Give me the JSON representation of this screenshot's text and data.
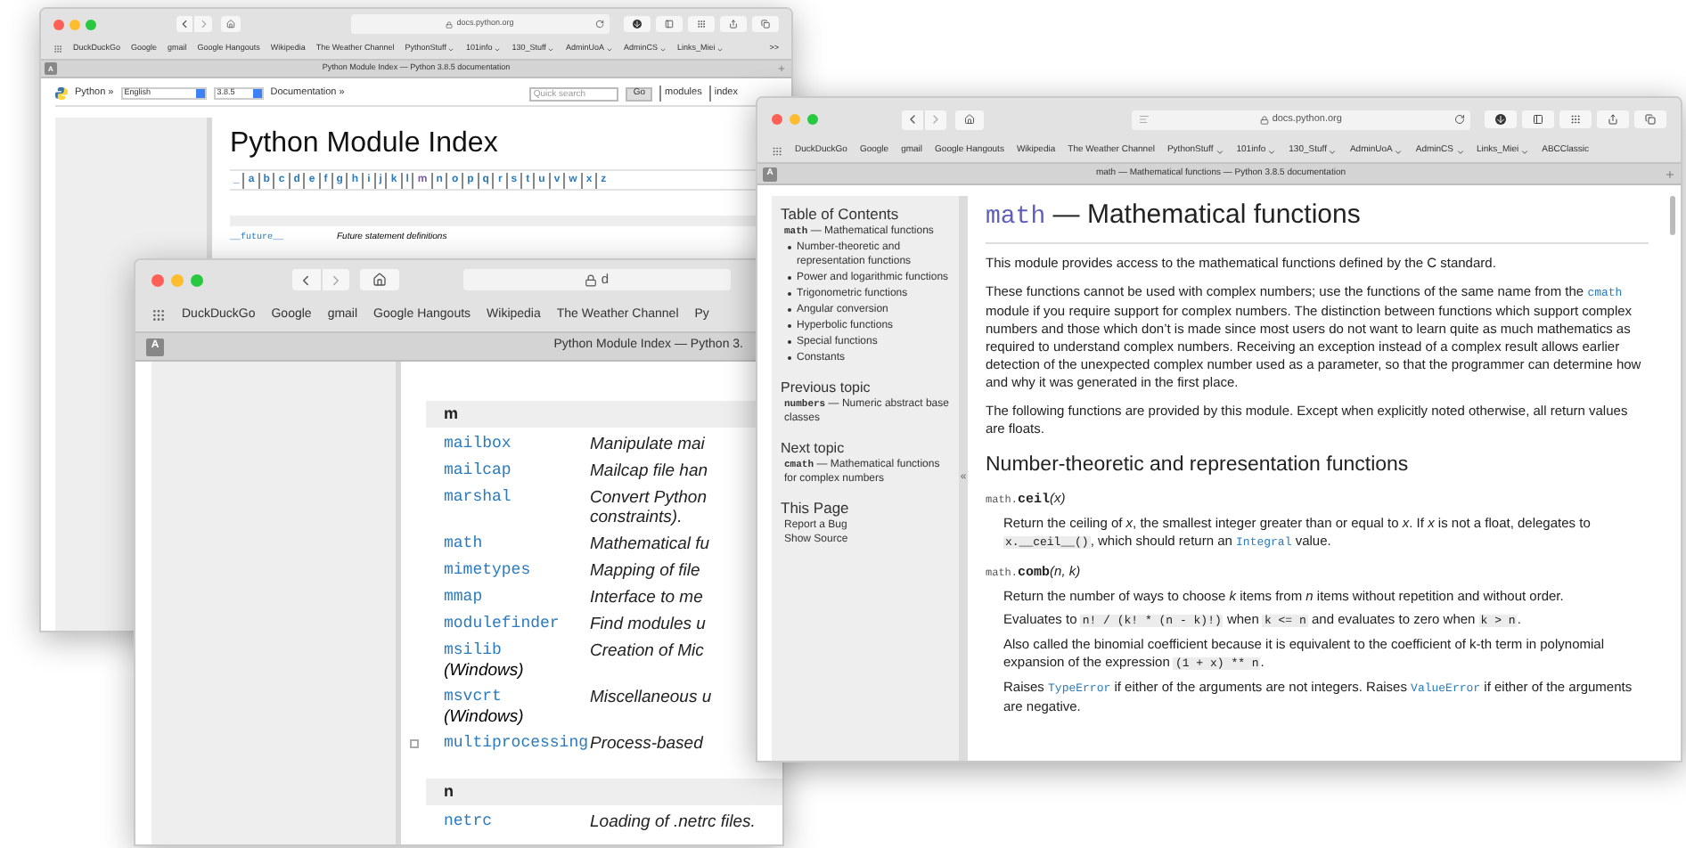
{
  "back_window": {
    "url": "docs.python.org",
    "bookmarks": [
      {
        "label": "DuckDuckGo",
        "menu": false
      },
      {
        "label": "Google",
        "menu": false
      },
      {
        "label": "gmail",
        "menu": false
      },
      {
        "label": "Google Hangouts",
        "menu": false
      },
      {
        "label": "Wikipedia",
        "menu": false
      },
      {
        "label": "The Weather Channel",
        "menu": false
      },
      {
        "label": "PythonStuff",
        "menu": true
      },
      {
        "label": "101info",
        "menu": true
      },
      {
        "label": "130_Stuff",
        "menu": true
      },
      {
        "label": "AdminUoA",
        "menu": true
      },
      {
        "label": "AdminCS",
        "menu": true
      },
      {
        "label": "Links_Miei",
        "menu": true
      }
    ],
    "overflow": ">>",
    "tab_icon": "A",
    "tab_title": "Python Module Index — Python 3.8.5 documentation",
    "nav": {
      "logo_link": "Python »",
      "language": "English",
      "version": "3.8.5",
      "docs_link": "Documentation »",
      "search_placeholder": "Quick search",
      "search_button": "Go",
      "links": [
        "modules",
        "index"
      ]
    },
    "heading": "Python Module Index",
    "letters": [
      {
        "text": "_",
        "visited": false
      },
      {
        "text": "a",
        "visited": false
      },
      {
        "text": "b",
        "visited": false
      },
      {
        "text": "c",
        "visited": false
      },
      {
        "text": "d",
        "visited": false
      },
      {
        "text": "e",
        "visited": false
      },
      {
        "text": "f",
        "visited": false
      },
      {
        "text": "g",
        "visited": false
      },
      {
        "text": "h",
        "visited": false
      },
      {
        "text": "i",
        "visited": false
      },
      {
        "text": "j",
        "visited": false
      },
      {
        "text": "k",
        "visited": false
      },
      {
        "text": "l",
        "visited": false
      },
      {
        "text": "m",
        "visited": true
      },
      {
        "text": "n",
        "visited": false
      },
      {
        "text": "o",
        "visited": false
      },
      {
        "text": "p",
        "visited": false
      },
      {
        "text": "q",
        "visited": false
      },
      {
        "text": "r",
        "visited": false
      },
      {
        "text": "s",
        "visited": false
      },
      {
        "text": "t",
        "visited": false
      },
      {
        "text": "u",
        "visited": false
      },
      {
        "text": "v",
        "visited": false
      },
      {
        "text": "w",
        "visited": false
      },
      {
        "text": "x",
        "visited": false
      },
      {
        "text": "z",
        "visited": false
      }
    ],
    "rows": [
      {
        "name": "__future__",
        "description": "Future statement definitions"
      }
    ]
  },
  "middle_window": {
    "url": "d",
    "bookmarks": [
      {
        "label": "DuckDuckGo",
        "menu": false
      },
      {
        "label": "Google",
        "menu": false
      },
      {
        "label": "gmail",
        "menu": false
      },
      {
        "label": "Google Hangouts",
        "menu": false
      },
      {
        "label": "Wikipedia",
        "menu": false
      },
      {
        "label": "The Weather Channel",
        "menu": false
      },
      {
        "label": "Py",
        "menu": false
      }
    ],
    "tab_icon": "A",
    "tab_title": "Python Module Index — Python 3.",
    "sections": [
      {
        "letter": "m",
        "rows": [
          {
            "name": "mailbox",
            "note": "",
            "collapsible": false,
            "description": [
              "Manipulate mai"
            ]
          },
          {
            "name": "mailcap",
            "note": "",
            "collapsible": false,
            "description": [
              "Mailcap file han"
            ]
          },
          {
            "name": "marshal",
            "note": "",
            "collapsible": false,
            "description": [
              "Convert Python",
              "constraints)."
            ]
          },
          {
            "name": "math",
            "note": "",
            "collapsible": false,
            "description": [
              "Mathematical fu"
            ]
          },
          {
            "name": "mimetypes",
            "note": "",
            "collapsible": false,
            "description": [
              "Mapping of file"
            ]
          },
          {
            "name": "mmap",
            "note": "",
            "collapsible": false,
            "description": [
              "Interface to me"
            ]
          },
          {
            "name": "modulefinder",
            "note": "",
            "collapsible": false,
            "description": [
              "Find modules u"
            ]
          },
          {
            "name": "msilib",
            "note": "(Windows)",
            "collapsible": false,
            "description": [
              "Creation of Mic"
            ]
          },
          {
            "name": "msvcrt",
            "note": "(Windows)",
            "collapsible": false,
            "description": [
              "Miscellaneous u"
            ]
          },
          {
            "name": "multiprocessing",
            "note": "",
            "collapsible": true,
            "description": [
              "Process-based"
            ]
          }
        ]
      },
      {
        "letter": "n",
        "rows": [
          {
            "name": "netrc",
            "note": "",
            "collapsible": false,
            "description": [
              "Loading of .netrc files."
            ]
          }
        ]
      }
    ]
  },
  "front_window": {
    "url": "docs.python.org",
    "bookmarks": [
      {
        "label": "DuckDuckGo",
        "menu": false
      },
      {
        "label": "Google",
        "menu": false
      },
      {
        "label": "gmail",
        "menu": false
      },
      {
        "label": "Google Hangouts",
        "menu": false
      },
      {
        "label": "Wikipedia",
        "menu": false
      },
      {
        "label": "The Weather Channel",
        "menu": false
      },
      {
        "label": "PythonStuff",
        "menu": true
      },
      {
        "label": "101info",
        "menu": true
      },
      {
        "label": "130_Stuff",
        "menu": true
      },
      {
        "label": "AdminUoA",
        "menu": true
      },
      {
        "label": "AdminCS",
        "menu": true
      },
      {
        "label": "Links_Miei",
        "menu": true
      },
      {
        "label": "ABCClassic",
        "menu": false
      }
    ],
    "tab_icon": "A",
    "tab_title": "math — Mathematical functions — Python 3.8.5 documentation",
    "sidebar": {
      "toc_title": "Table of Contents",
      "toc_code": "math",
      "toc_text": "— Mathematical functions",
      "toc_items": [
        "Number-theoretic and representation functions",
        "Power and logarithmic functions",
        "Trigonometric functions",
        "Angular conversion",
        "Hyperbolic functions",
        "Special functions",
        "Constants"
      ],
      "sections": [
        {
          "title": "Previous topic",
          "code": "numbers",
          "text": "— Numeric abstract base classes"
        },
        {
          "title": "Next topic",
          "code": "cmath",
          "text": "— Mathematical functions for complex numbers"
        }
      ],
      "page_title": "This Page",
      "page_links": [
        "Report a Bug",
        "Show Source"
      ],
      "collapse": "«"
    },
    "heading_code": "math",
    "heading_text": "— Mathematical functions",
    "paragraphs": [
      [
        {
          "kind": "text",
          "text": "This module provides access to the mathematical functions defined by the C standard."
        }
      ],
      [
        {
          "kind": "text",
          "text": "These functions cannot be used with complex numbers; use the functions of the same name from the "
        },
        {
          "kind": "link",
          "text": "cmath"
        },
        {
          "kind": "text",
          "text": " module if you require support for complex numbers. The distinction between functions which support complex numbers and those which don’t is made since most users do not want to learn quite as much mathematics as required to understand complex numbers. Receiving an exception instead of a complex result allows earlier detection of the unexpected complex number used as a parameter, so that the programmer can determine how and why it was generated in the first place."
        }
      ],
      [
        {
          "kind": "text",
          "text": "The following functions are provided by this module. Except when explicitly noted otherwise, all return values are floats."
        }
      ]
    ],
    "section_heading": "Number-theoretic and representation functions",
    "functions": [
      {
        "prefix": "math.",
        "name": "ceil",
        "args": "(x)",
        "paragraphs": [
          [
            {
              "kind": "text",
              "text": "Return the ceiling of "
            },
            {
              "kind": "em",
              "text": "x"
            },
            {
              "kind": "text",
              "text": ", the smallest integer greater than or equal to "
            },
            {
              "kind": "em",
              "text": "x"
            },
            {
              "kind": "text",
              "text": ". If "
            },
            {
              "kind": "em",
              "text": "x"
            },
            {
              "kind": "text",
              "text": " is not a float, delegates to "
            },
            {
              "kind": "code",
              "text": "x.__ceil__()"
            },
            {
              "kind": "text",
              "text": ", which should return an "
            },
            {
              "kind": "link",
              "text": "Integral"
            },
            {
              "kind": "text",
              "text": " value."
            }
          ]
        ]
      },
      {
        "prefix": "math.",
        "name": "comb",
        "args": "(n, k)",
        "paragraphs": [
          [
            {
              "kind": "text",
              "text": "Return the number of ways to choose "
            },
            {
              "kind": "em",
              "text": "k"
            },
            {
              "kind": "text",
              "text": " items from "
            },
            {
              "kind": "em",
              "text": "n"
            },
            {
              "kind": "text",
              "text": " items without repetition and without order."
            }
          ],
          [
            {
              "kind": "text",
              "text": "Evaluates to "
            },
            {
              "kind": "code",
              "text": "n! / (k! * (n - k)!)"
            },
            {
              "kind": "text",
              "text": " when "
            },
            {
              "kind": "code",
              "text": "k <= n"
            },
            {
              "kind": "text",
              "text": " and evaluates to zero when "
            },
            {
              "kind": "code",
              "text": "k > n"
            },
            {
              "kind": "text",
              "text": "."
            }
          ],
          [
            {
              "kind": "text",
              "text": "Also called the binomial coefficient because it is equivalent to the coefficient of k-th term in polynomial expansion of the expression "
            },
            {
              "kind": "code",
              "text": "(1 + x) ** n"
            },
            {
              "kind": "text",
              "text": "."
            }
          ],
          [
            {
              "kind": "text",
              "text": "Raises "
            },
            {
              "kind": "link",
              "text": "TypeError"
            },
            {
              "kind": "text",
              "text": " if either of the arguments are not integers. Raises "
            },
            {
              "kind": "link",
              "text": "ValueError"
            },
            {
              "kind": "text",
              "text": " if either of the arguments are negative."
            }
          ]
        ]
      }
    ]
  }
}
